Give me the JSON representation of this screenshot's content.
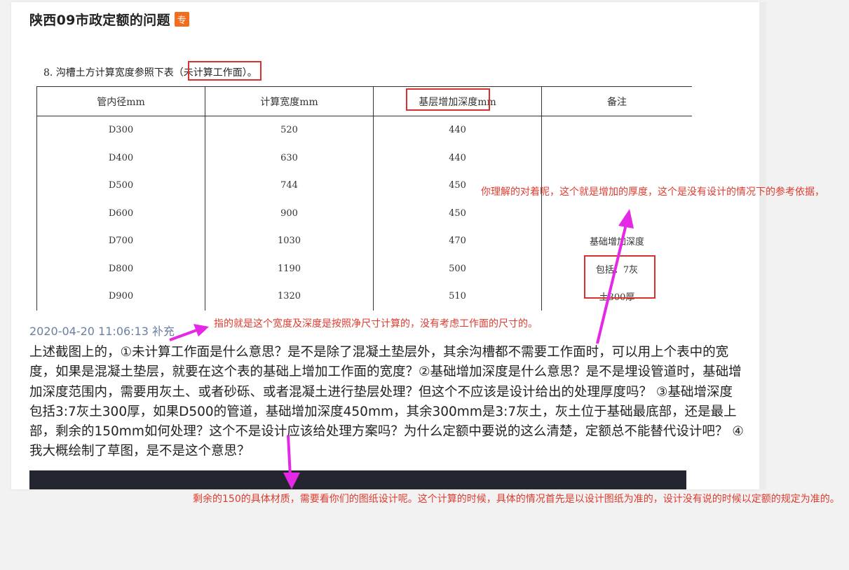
{
  "header": {
    "title": "陕西09市政定额的问题",
    "badge": "专"
  },
  "table": {
    "caption": "8. 沟槽土方计算宽度参照下表（未计算工作面）。",
    "columns": [
      "管内径mm",
      "计算宽度mm",
      "基层增加深度mm",
      "备注"
    ],
    "rows": [
      [
        "D300",
        "520",
        "440",
        ""
      ],
      [
        "D400",
        "630",
        "440",
        ""
      ],
      [
        "D500",
        "744",
        "450",
        ""
      ],
      [
        "D600",
        "900",
        "450",
        ""
      ],
      [
        "D700",
        "1030",
        "470",
        "基础增加深度"
      ],
      [
        "D800",
        "1190",
        "500",
        "包括：7灰"
      ],
      [
        "D900",
        "1320",
        "510",
        "土300厚"
      ]
    ]
  },
  "post": {
    "timestamp": "2020-04-20 11:06:13 补充",
    "question": "上述截图上的，①未计算工作面是什么意思？是不是除了混凝土垫层外，其余沟槽都不需要工作面时，可以用上个表中的宽度，如果是混凝土垫层，就要在这个表的基础上增加工作面的宽度？②基础增加深度是什么意思？是不是埋设管道时，基础增加深度范围内，需要用灰土、或者砂砾、或者混凝土进行垫层处理？但这个不应该是设计给出的处理厚度吗？ ③基础增深度包括3:7灰土300厚，如果D500的管道，基础增加深度450mm，其余300mm是3:7灰土，灰土位于基础最底部，还是最上部，剩余的150mm如何处理？这个不是设计应该给处理方案吗？为什么定额中要说的这么清楚，定额总不能替代设计吧？ ④我大概绘制了草图，是不是这个意思？"
  },
  "annotations": {
    "depth_note": "你理解的对着呢，这个就是增加的厚度，这个是没有设计的情况下的参考依据，",
    "width_note": "指的就是这个宽度及深度是按照净尺寸计算的，没有考虑工作面的尺寸的。",
    "remaining_note": "剩余的150的具体材质，需要看你们的图纸设计呢。这个计算的时候，具体的情况首先是以设计图纸为准的，设计没有说的时候以定额的规定为准的。",
    "color": "#e03b2f",
    "arrow_color": "#e528e5"
  }
}
